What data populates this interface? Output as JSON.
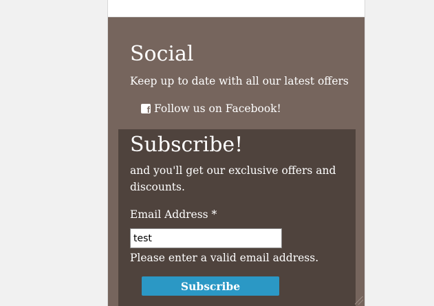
{
  "social": {
    "heading": "Social",
    "text": "Keep up to date with all our latest offers",
    "facebook_icon": "facebook-square-icon",
    "facebook_label": "Follow us on Facebook!"
  },
  "subscribe": {
    "heading": "Subscribe!",
    "text": "and you'll get our exclusive offers and discounts.",
    "email_label": "Email Address *",
    "email_value": "test",
    "error": "Please enter a valid email address.",
    "button_label": "Subscribe"
  },
  "colors": {
    "page_background": "#f1f1f1",
    "panel": "#76655d",
    "subscribe_box": "#4f433d",
    "button": "#2b98c5"
  }
}
